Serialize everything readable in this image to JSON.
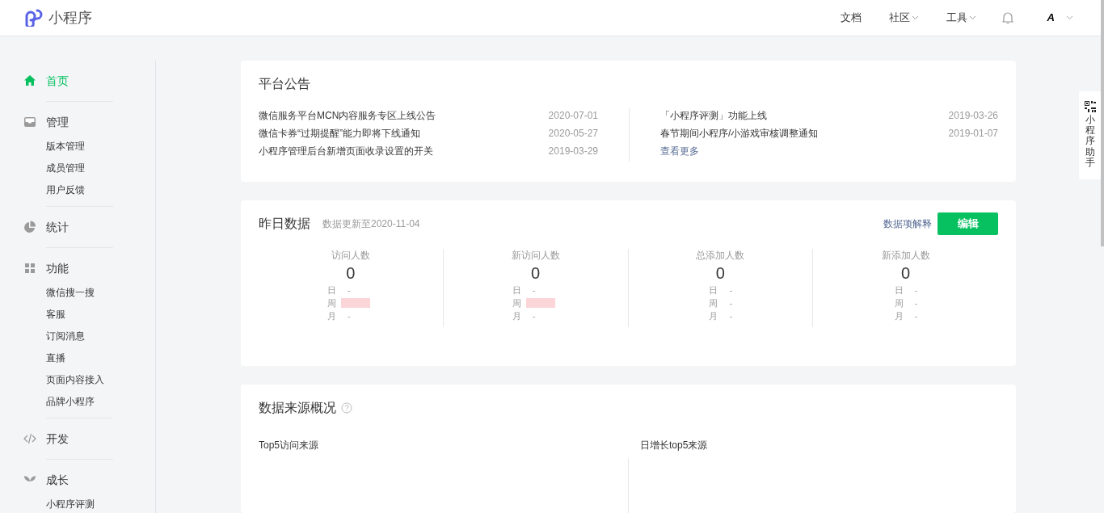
{
  "header": {
    "logo_text": "小程序",
    "nav": [
      {
        "label": "文档",
        "dropdown": false
      },
      {
        "label": "社区",
        "dropdown": true
      },
      {
        "label": "工具",
        "dropdown": true
      }
    ],
    "avatar_text": "A"
  },
  "sidebar": {
    "groups": [
      {
        "title": "首页",
        "selected": true
      },
      {
        "title": "管理",
        "selected": false,
        "children": [
          {
            "label": "版本管理"
          },
          {
            "label": "成员管理"
          },
          {
            "label": "用户反馈"
          }
        ]
      },
      {
        "title": "统计",
        "selected": false
      },
      {
        "title": "功能",
        "selected": false,
        "children": [
          {
            "label": "微信搜一搜"
          },
          {
            "label": "客服"
          },
          {
            "label": "订阅消息"
          },
          {
            "label": "直播"
          },
          {
            "label": "页面内容接入"
          },
          {
            "label": "品牌小程序"
          }
        ]
      },
      {
        "title": "开发",
        "selected": false
      },
      {
        "title": "成长",
        "selected": false,
        "children": [
          {
            "label": "小程序评测"
          }
        ]
      }
    ]
  },
  "announcements": {
    "title": "平台公告",
    "left": [
      {
        "text": "微信服务平台MCN内容服务专区上线公告",
        "date": "2020-07-01"
      },
      {
        "text": "微信卡券“过期提醒”能力即将下线通知",
        "date": "2020-05-27"
      },
      {
        "text": "小程序管理后台新增页面收录设置的开关",
        "date": "2019-03-29"
      }
    ],
    "right": [
      {
        "text": "「小程序评测」功能上线",
        "date": "2019-03-26"
      },
      {
        "text": "春节期间小程序/小游戏审核调整通知",
        "date": "2019-01-07"
      }
    ],
    "more_link": "查看更多"
  },
  "yesterday": {
    "title": "昨日数据",
    "updated": "数据更新至2020-11-04",
    "explain_link": "数据项解释",
    "edit_button": "编辑",
    "metrics": [
      {
        "label": "访问人数",
        "value": "0",
        "rows": [
          {
            "label": "日",
            "value": "-",
            "redacted": false
          },
          {
            "label": "周",
            "redacted": true
          },
          {
            "label": "月",
            "value": "-",
            "redacted": false
          }
        ]
      },
      {
        "label": "新访问人数",
        "value": "0",
        "rows": [
          {
            "label": "日",
            "value": "-",
            "redacted": false
          },
          {
            "label": "周",
            "redacted": true
          },
          {
            "label": "月",
            "value": "-",
            "redacted": false
          }
        ]
      },
      {
        "label": "总添加人数",
        "value": "0",
        "rows": [
          {
            "label": "日",
            "value": "-",
            "redacted": false
          },
          {
            "label": "周",
            "value": "-",
            "redacted": false
          },
          {
            "label": "月",
            "value": "-",
            "redacted": false
          }
        ]
      },
      {
        "label": "新添加人数",
        "value": "0",
        "rows": [
          {
            "label": "日",
            "value": "-",
            "redacted": false
          },
          {
            "label": "周",
            "value": "-",
            "redacted": false
          },
          {
            "label": "月",
            "value": "-",
            "redacted": false
          }
        ]
      }
    ]
  },
  "sources": {
    "title": "数据来源概况",
    "columns": [
      "Top5访问来源",
      "日增长top5来源"
    ]
  },
  "helper": {
    "label": "小程序助手"
  }
}
